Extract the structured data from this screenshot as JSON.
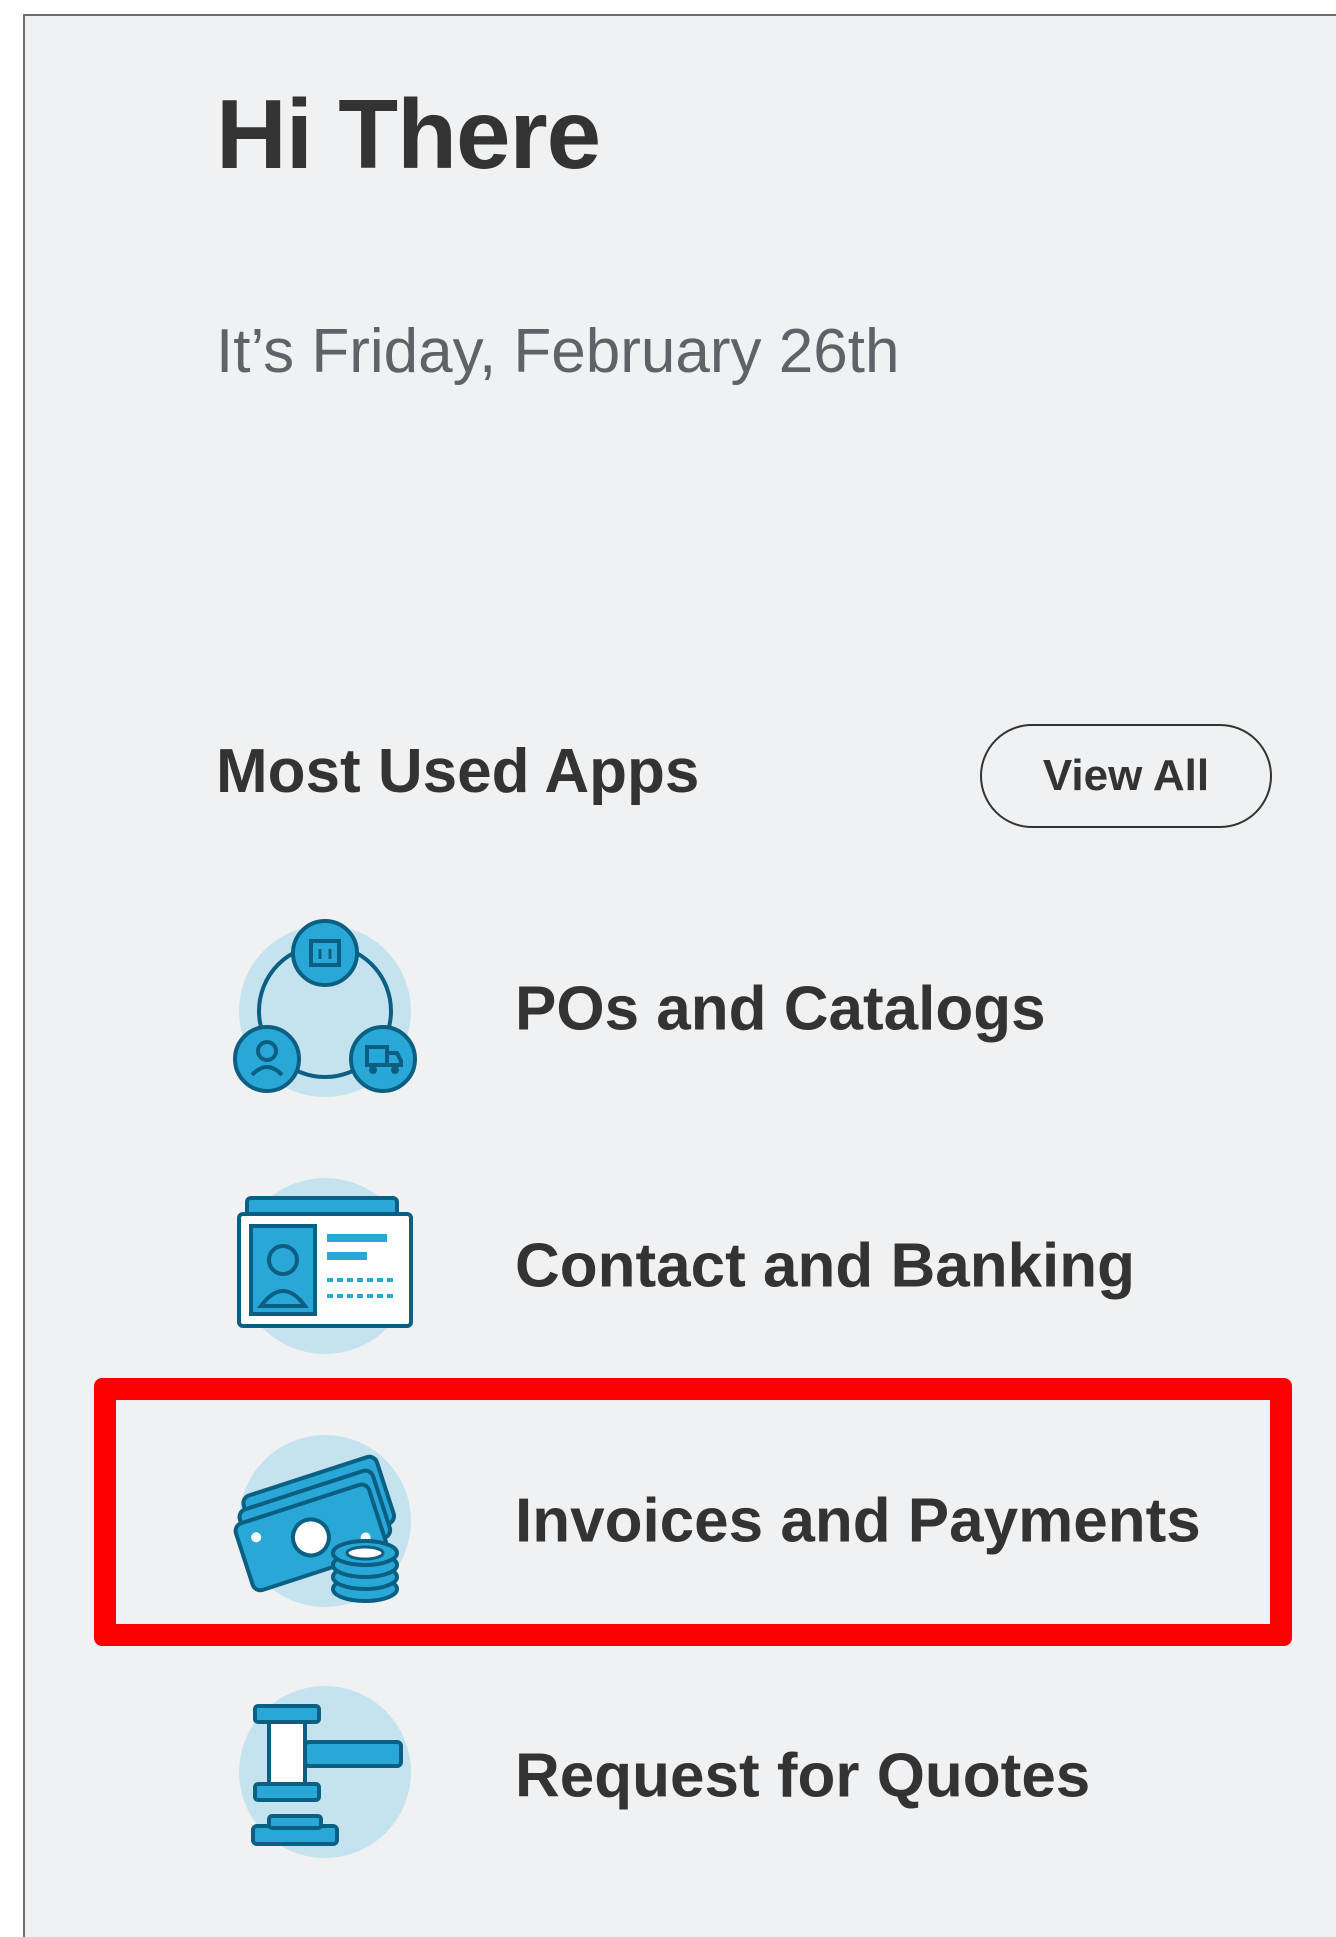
{
  "greeting": "Hi There",
  "date_text": "It’s Friday, February 26th",
  "most_used": {
    "heading": "Most Used Apps",
    "view_all_label": "View All"
  },
  "apps": [
    {
      "label": "POs and Catalogs",
      "icon": "pos-catalogs-icon"
    },
    {
      "label": "Contact and Banking",
      "icon": "contact-card-icon"
    },
    {
      "label": "Invoices and Payments",
      "icon": "money-coins-icon"
    },
    {
      "label": "Request for Quotes",
      "icon": "gavel-icon"
    }
  ],
  "colors": {
    "panel_bg": "#f0f1f2",
    "icon_bg": "#c5e3ee",
    "icon_blue": "#29a8d8",
    "icon_dark": "#0b5f82",
    "highlight": "#ff0000",
    "text": "#333333"
  }
}
